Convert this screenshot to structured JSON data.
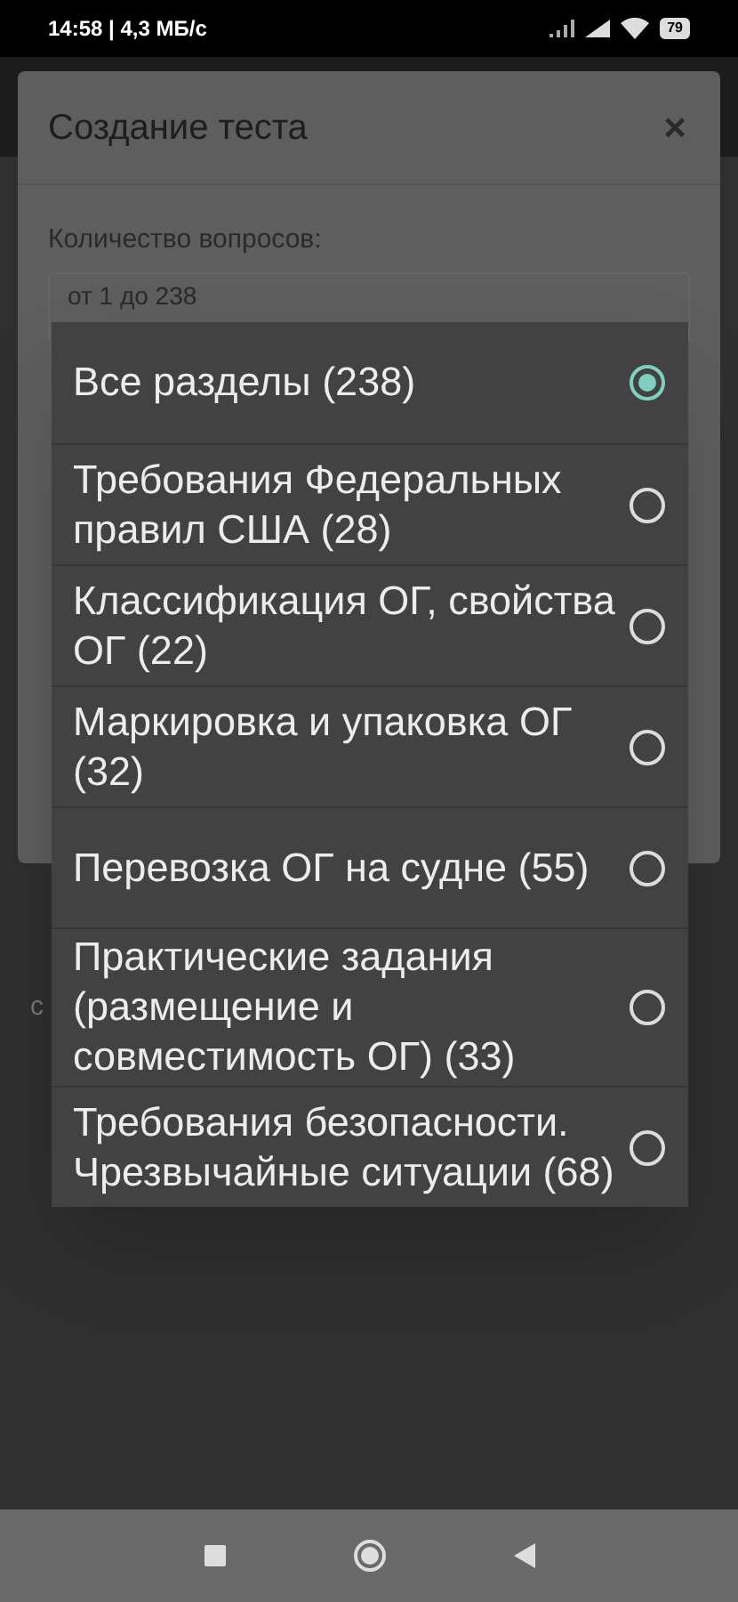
{
  "status_bar": {
    "time": "14:58 | 4,3 МБ/с",
    "battery": "79"
  },
  "dialog": {
    "title": "Создание теста",
    "close": "×",
    "count_label": "Количество вопросов:",
    "count_placeholder": "от 1 до 238"
  },
  "behind_text": "c",
  "sections": [
    {
      "label": "Все разделы (238)",
      "selected": true
    },
    {
      "label": "Требования Федеральных правил США (28)",
      "selected": false
    },
    {
      "label": "Классификация ОГ, свойства ОГ (22)",
      "selected": false
    },
    {
      "label": "Маркировка и упаковка ОГ (32)",
      "selected": false
    },
    {
      "label": "Перевозка ОГ на судне (55)",
      "selected": false
    },
    {
      "label": "Практические задания (размещение и совместимость ОГ) (33)",
      "selected": false
    },
    {
      "label": "Требования безопасности. Чрезвычайные ситуации (68)",
      "selected": false
    }
  ]
}
